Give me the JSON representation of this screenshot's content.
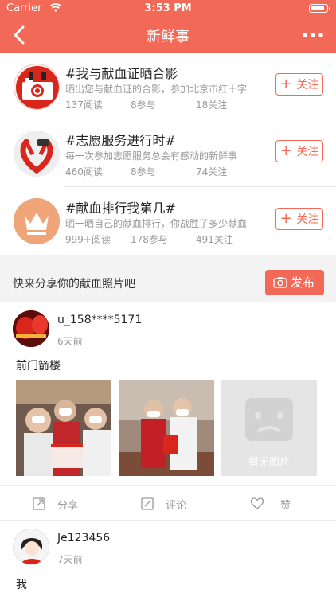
{
  "status_bar": {
    "carrier": "Carrier",
    "time": "3:53 PM"
  },
  "nav": {
    "title": "新鲜事"
  },
  "topics": [
    {
      "title": "#我与献血证晒合影",
      "desc": "晒出您与献血证的合影，参加北京市红十字",
      "reads": "137阅读",
      "joins": "8参与",
      "follows": "18关注",
      "follow_label": "关注",
      "icon": "camera-icon"
    },
    {
      "title": "#志愿服务进行时#",
      "desc": "每一次参加志愿服务总会有感动的新鲜事",
      "reads": "460阅读",
      "joins": "8参与",
      "follows": "74关注",
      "follow_label": "关注",
      "icon": "heart-hands-icon"
    },
    {
      "title": "#献血排行我第几#",
      "desc": "晒一晒自己的献血排行，你战胜了多少献血",
      "reads": "999+阅读",
      "joins": "178参与",
      "follows": "491关注",
      "follow_label": "关注",
      "icon": "crown-icon"
    }
  ],
  "share": {
    "prompt": "快来分享你的献血照片吧",
    "publish_label": "发布"
  },
  "posts": [
    {
      "user": "u_158****5171",
      "time": "6天前",
      "content": "前门箭楼",
      "no_image_label": "暂无图片"
    },
    {
      "user": "Je123456",
      "time": "7天前",
      "content": "我"
    }
  ],
  "actions": {
    "share": "分享",
    "comment": "评论",
    "like": "赞"
  },
  "colors": {
    "accent": "#f26a57"
  }
}
